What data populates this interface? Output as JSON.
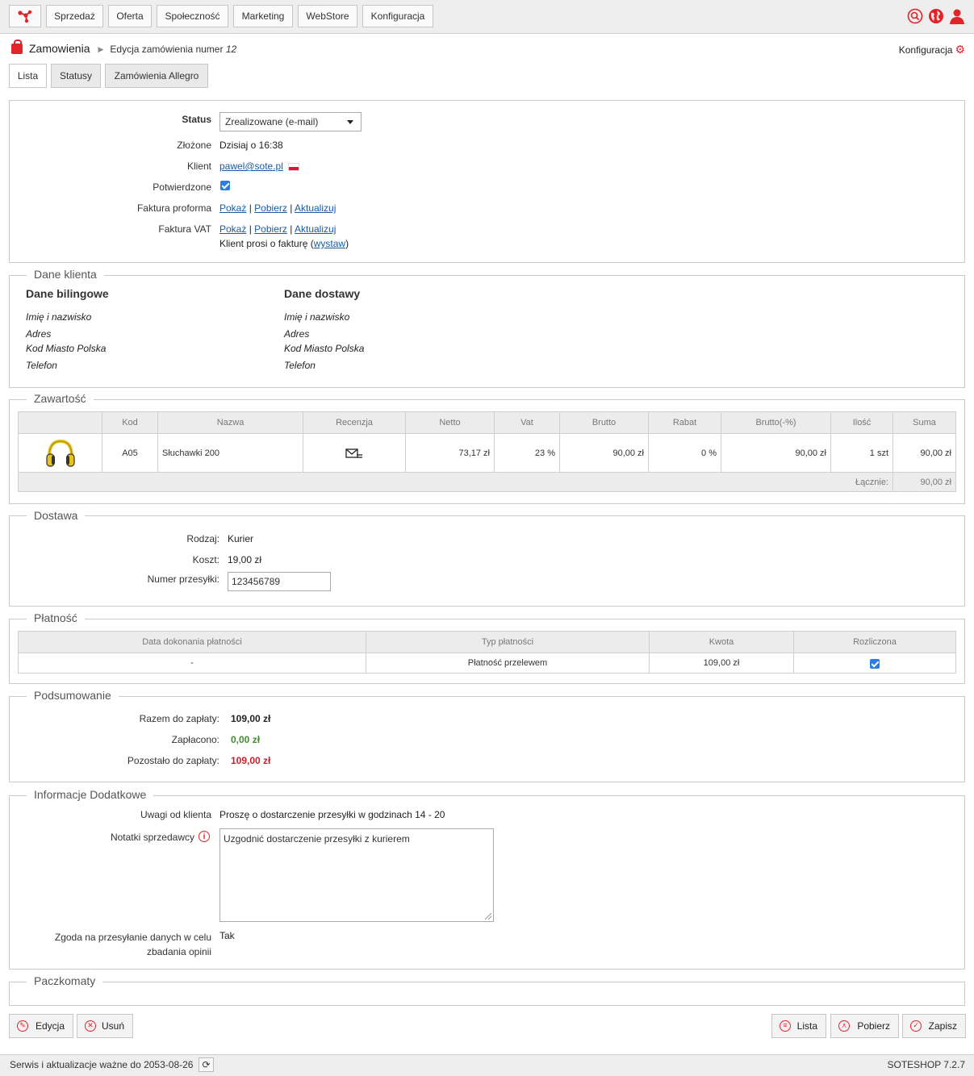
{
  "topnav": {
    "items": [
      "Sprzedaż",
      "Oferta",
      "Społeczność",
      "Marketing",
      "WebStore",
      "Konfiguracja"
    ]
  },
  "colors": {
    "accent": "#e2232a",
    "link": "#1a5a9e",
    "paid": "#3f8f2f",
    "due": "#c8202a"
  },
  "icons": {
    "logo": "share-nodes-logo",
    "search": "search-icon",
    "globe": "globe-icon",
    "user": "user-icon"
  },
  "breadcrumb": {
    "title": "Zamowienia",
    "sub_prefix": "Edycja zamówienia numer",
    "order_number": "12"
  },
  "config_link": "Konfiguracja",
  "tabs": [
    "Lista",
    "Statusy",
    "Zamówienia Allegro"
  ],
  "order": {
    "status_label": "Status",
    "status_value": "Zrealizowane (e-mail)",
    "zlozone_label": "Złożone",
    "zlozone_value": "Dzisiaj o 16:38",
    "klient_label": "Klient",
    "klient_email": "pawel@sote.pl",
    "potwierdzone_label": "Potwierdzone",
    "proforma_label": "Faktura proforma",
    "vat_label": "Faktura VAT",
    "links": {
      "pokaz": "Pokaż",
      "pobierz": "Pobierz",
      "aktualizuj": "Aktualizuj",
      "sep": "|"
    },
    "request_prefix": "Klient prosi o fakturę (",
    "request_link": "wystaw",
    "request_suffix": ")"
  },
  "client": {
    "legend": "Dane klienta",
    "billing_title": "Dane bilingowe",
    "shipping_title": "Dane dostawy",
    "fields": [
      "Imię i nazwisko",
      "Adres",
      "Kod Miasto Polska",
      "Telefon"
    ]
  },
  "contents": {
    "legend": "Zawartość",
    "headers": [
      "",
      "Kod",
      "Nazwa",
      "Recenzja",
      "Netto",
      "Vat",
      "Brutto",
      "Rabat",
      "Brutto(-%)",
      "Ilość",
      "Suma"
    ],
    "row": {
      "kod": "A05",
      "nazwa": "Słuchawki 200",
      "netto": "73,17 zł",
      "vat": "23 %",
      "brutto": "90,00 zł",
      "rabat": "0 %",
      "brutto_pct": "90,00 zł",
      "ilosc": "1 szt",
      "suma": "90,00 zł"
    },
    "total_label": "Łącznie:",
    "total_value": "90,00 zł"
  },
  "delivery": {
    "legend": "Dostawa",
    "rodzaj_label": "Rodzaj:",
    "rodzaj_value": "Kurier",
    "koszt_label": "Koszt:",
    "koszt_value": "19,00 zł",
    "numer_label": "Numer przesyłki:",
    "numer_value": "123456789"
  },
  "payment": {
    "legend": "Płatność",
    "headers": [
      "Data dokonania płatności",
      "Typ płatności",
      "Kwota",
      "Rozliczona"
    ],
    "row": {
      "date": "-",
      "type": "Płatność przelewem",
      "amount": "109,00 zł"
    }
  },
  "summary": {
    "legend": "Podsumowanie",
    "razem_label": "Razem do zapłaty:",
    "razem_value": "109,00 zł",
    "zaplacono_label": "Zapłacono:",
    "zaplacono_value": "0,00 zł",
    "pozostalo_label": "Pozostało do zapłaty:",
    "pozostalo_value": "109,00 zł"
  },
  "extra": {
    "legend": "Informacje Dodatkowe",
    "uwagi_label": "Uwagi od klienta",
    "uwagi_value": "Proszę o dostarczenie przesyłki w godzinach 14 - 20",
    "notatki_label": "Notatki sprzedawcy",
    "notatki_value": "Uzgodnić dostarczenie przesyłki z kurierem",
    "zgoda_label_1": "Zgoda na przesyłanie danych w celu",
    "zgoda_label_2": "zbadania opinii",
    "zgoda_value": "Tak"
  },
  "paczkomaty": {
    "legend": "Paczkomaty"
  },
  "actions": {
    "edycja": "Edycja",
    "usun": "Usuń",
    "lista": "Lista",
    "pobierz": "Pobierz",
    "zapisz": "Zapisz"
  },
  "footer": {
    "service": "Serwis i aktualizacje ważne do 2053-08-26",
    "version": "SOTESHOP 7.2.7"
  }
}
